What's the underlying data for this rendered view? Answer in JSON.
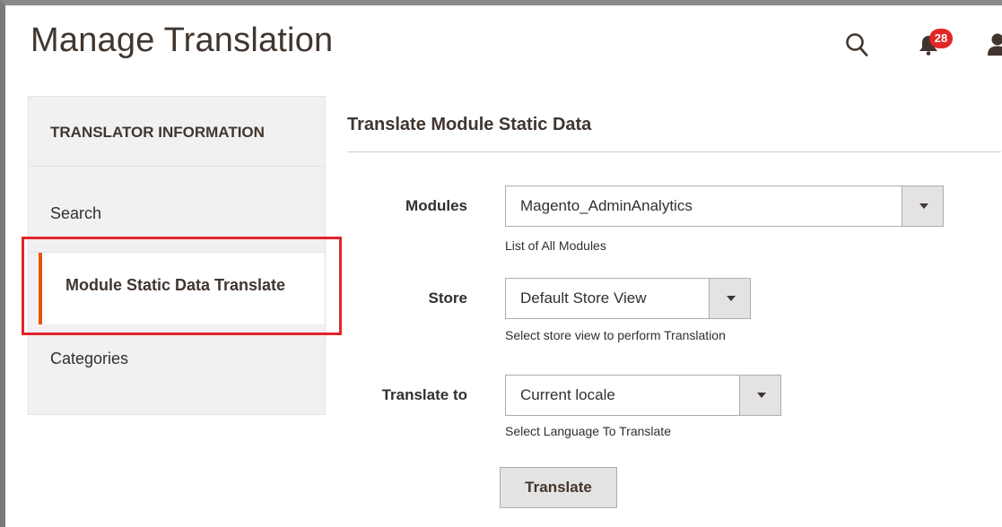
{
  "header": {
    "title": "Manage Translation",
    "notification_count": "28",
    "icons": [
      "search-icon",
      "bell-icon",
      "user-icon"
    ]
  },
  "sidebar": {
    "title": "TRANSLATOR INFORMATION",
    "items": [
      {
        "label": "Search",
        "active": false
      },
      {
        "label": "Module Static Data Translate",
        "active": true
      },
      {
        "label": "Categories",
        "active": false
      }
    ]
  },
  "main": {
    "section_title": "Translate Module Static Data",
    "fields": [
      {
        "label": "Modules",
        "value": "Magento_AdminAnalytics",
        "note": "List of All Modules"
      },
      {
        "label": "Store",
        "value": "Default Store View",
        "note": "Select store view to perform Translation"
      },
      {
        "label": "Translate to",
        "value": "Current locale",
        "note": "Select Language To Translate"
      }
    ],
    "submit_label": "Translate"
  },
  "colors": {
    "accent": "#eb5202",
    "badge": "#e22626",
    "highlight": "#e3242b"
  }
}
